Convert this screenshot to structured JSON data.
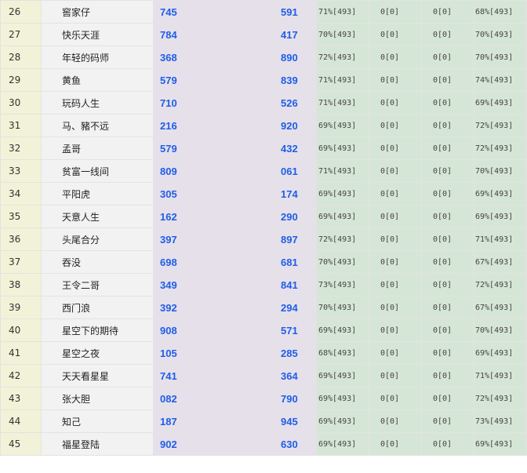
{
  "rows": [
    {
      "rank": "26",
      "name": "窖家仔",
      "a": "745",
      "b": "591",
      "s1": "71%[493]",
      "s2": "0[0]",
      "s3": "0[0]",
      "s4": "68%[493]"
    },
    {
      "rank": "27",
      "name": "快乐天涯",
      "a": "784",
      "b": "417",
      "s1": "70%[493]",
      "s2": "0[0]",
      "s3": "0[0]",
      "s4": "70%[493]"
    },
    {
      "rank": "28",
      "name": "年轻的码师",
      "a": "368",
      "b": "890",
      "s1": "72%[493]",
      "s2": "0[0]",
      "s3": "0[0]",
      "s4": "70%[493]"
    },
    {
      "rank": "29",
      "name": "黄鱼",
      "a": "579",
      "b": "839",
      "s1": "71%[493]",
      "s2": "0[0]",
      "s3": "0[0]",
      "s4": "74%[493]"
    },
    {
      "rank": "30",
      "name": "玩码人生",
      "a": "710",
      "b": "526",
      "s1": "71%[493]",
      "s2": "0[0]",
      "s3": "0[0]",
      "s4": "69%[493]"
    },
    {
      "rank": "31",
      "name": "马、豬不远",
      "a": "216",
      "b": "920",
      "s1": "69%[493]",
      "s2": "0[0]",
      "s3": "0[0]",
      "s4": "72%[493]"
    },
    {
      "rank": "32",
      "name": "孟哥",
      "a": "579",
      "b": "432",
      "s1": "69%[493]",
      "s2": "0[0]",
      "s3": "0[0]",
      "s4": "72%[493]"
    },
    {
      "rank": "33",
      "name": "贫富一线间",
      "a": "809",
      "b": "061",
      "s1": "71%[493]",
      "s2": "0[0]",
      "s3": "0[0]",
      "s4": "70%[493]"
    },
    {
      "rank": "34",
      "name": "平阳虎",
      "a": "305",
      "b": "174",
      "s1": "69%[493]",
      "s2": "0[0]",
      "s3": "0[0]",
      "s4": "69%[493]"
    },
    {
      "rank": "35",
      "name": "天意人生",
      "a": "162",
      "b": "290",
      "s1": "69%[493]",
      "s2": "0[0]",
      "s3": "0[0]",
      "s4": "69%[493]"
    },
    {
      "rank": "36",
      "name": "头尾合分",
      "a": "397",
      "b": "897",
      "s1": "72%[493]",
      "s2": "0[0]",
      "s3": "0[0]",
      "s4": "71%[493]"
    },
    {
      "rank": "37",
      "name": "吞没",
      "a": "698",
      "b": "681",
      "s1": "70%[493]",
      "s2": "0[0]",
      "s3": "0[0]",
      "s4": "67%[493]"
    },
    {
      "rank": "38",
      "name": "王令二哥",
      "a": "349",
      "b": "841",
      "s1": "73%[493]",
      "s2": "0[0]",
      "s3": "0[0]",
      "s4": "72%[493]"
    },
    {
      "rank": "39",
      "name": "西门浪",
      "a": "392",
      "b": "294",
      "s1": "70%[493]",
      "s2": "0[0]",
      "s3": "0[0]",
      "s4": "67%[493]"
    },
    {
      "rank": "40",
      "name": "星空下的期待",
      "a": "908",
      "b": "571",
      "s1": "69%[493]",
      "s2": "0[0]",
      "s3": "0[0]",
      "s4": "70%[493]"
    },
    {
      "rank": "41",
      "name": "星空之夜",
      "a": "105",
      "b": "285",
      "s1": "68%[493]",
      "s2": "0[0]",
      "s3": "0[0]",
      "s4": "69%[493]"
    },
    {
      "rank": "42",
      "name": "天天看星星",
      "a": "741",
      "b": "364",
      "s1": "69%[493]",
      "s2": "0[0]",
      "s3": "0[0]",
      "s4": "71%[493]"
    },
    {
      "rank": "43",
      "name": "张大胆",
      "a": "082",
      "b": "790",
      "s1": "69%[493]",
      "s2": "0[0]",
      "s3": "0[0]",
      "s4": "72%[493]"
    },
    {
      "rank": "44",
      "name": "知己",
      "a": "187",
      "b": "945",
      "s1": "69%[493]",
      "s2": "0[0]",
      "s3": "0[0]",
      "s4": "73%[493]"
    },
    {
      "rank": "45",
      "name": "福星登陆",
      "a": "902",
      "b": "630",
      "s1": "69%[493]",
      "s2": "0[0]",
      "s3": "0[0]",
      "s4": "69%[493]"
    }
  ]
}
